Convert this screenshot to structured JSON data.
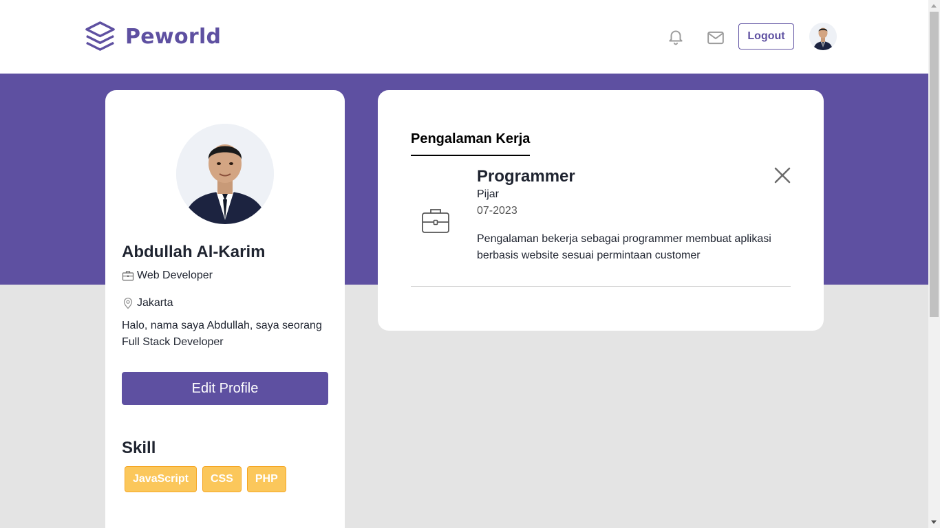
{
  "navbar": {
    "brand": "Peworld",
    "logo_icon": "layers-icon",
    "notification_icon": "bell-icon",
    "message_icon": "mail-icon",
    "logout_label": "Logout",
    "avatar": "avatar"
  },
  "profile": {
    "name": "Abdullah Al-Karim",
    "job": "Web Developer",
    "location": "Jakarta",
    "bio": "Halo, nama saya Abdullah, saya seorang Full Stack Developer",
    "edit_label": "Edit Profile",
    "skill_title": "Skill",
    "skills": [
      "JavaScript",
      "CSS",
      "PHP"
    ]
  },
  "experience": {
    "tab_label": "Pengalaman Kerja",
    "items": [
      {
        "position": "Programmer",
        "company": "Pijar",
        "date": "07-2023",
        "description": "Pengalaman bekerja sebagai programmer membuat aplikasi berbasis website sesuai permintaan customer"
      }
    ]
  },
  "colors": {
    "primary": "#5e50a1",
    "skill_bg": "#fbc75b",
    "skill_border": "#f5a623",
    "page_bg": "#e4e4e4"
  }
}
